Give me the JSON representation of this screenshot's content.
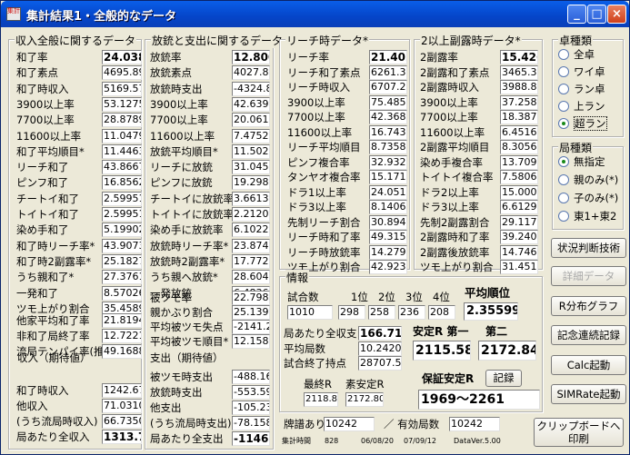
{
  "window": {
    "title": "集計結果1・全般的なデータ",
    "icon_text": "集計",
    "minimize": "_",
    "maximize": "□",
    "close": "×"
  },
  "g1": {
    "caption": "収入全般に関するデータ",
    "rows": [
      {
        "label": "和了率",
        "value": "24.038",
        "bold": true
      },
      {
        "label": "和了素点",
        "value": "4695.89"
      },
      {
        "label": "和了時収入",
        "value": "5169.57"
      },
      {
        "label": "3900以上率",
        "value": "53.1275"
      },
      {
        "label": "7700以上率",
        "value": "28.8789"
      },
      {
        "label": "11600以上率",
        "value": "11.0479"
      },
      {
        "label": "和了平均順目*",
        "value": "11.4463"
      },
      {
        "label": "リーチ和了",
        "value": "43.8667"
      },
      {
        "label": "ピンフ和了",
        "value": "16.8562"
      },
      {
        "label": "チートイ和了",
        "value": "2.59951"
      },
      {
        "label": "トイトイ和了",
        "value": "2.59951"
      },
      {
        "label": "染め手和了",
        "value": "5.19902"
      },
      {
        "label": "和了時リーチ率*",
        "value": "43.9073"
      },
      {
        "label": "和了時2副露率*",
        "value": "25.1827"
      },
      {
        "label": "うち親和了*",
        "value": "27.3761"
      },
      {
        "label": "一発和了",
        "value": "8.57026"
      },
      {
        "label": "ツモ上がり割合",
        "value": "35.4589"
      }
    ],
    "rows2": [
      {
        "label": "他家平均和了率",
        "value": "21.8194"
      },
      {
        "label": "非和了局終了率",
        "value": "12.7221"
      },
      {
        "label": "流局テンパイ率(推)",
        "value": "49.1688"
      }
    ],
    "income_caption": "収入（期待値）",
    "rows3": [
      {
        "label": "和了時収入",
        "value": "1242.67"
      },
      {
        "label": "他収入",
        "value": "71.0310"
      },
      {
        "label": "(うち流局時収入)",
        "value": "66.7350"
      },
      {
        "label": "局あたり全収入",
        "value": "1313.70",
        "bold": true
      }
    ]
  },
  "g2": {
    "caption": "放銃と支出に関するデータ",
    "rows": [
      {
        "label": "放銃率",
        "value": "12.800",
        "bold": true
      },
      {
        "label": "放銃素点",
        "value": "4027.84"
      },
      {
        "label": "放銃時支出",
        "value": "-4324.8"
      },
      {
        "label": "3900以上率",
        "value": "42.6392"
      },
      {
        "label": "7700以上率",
        "value": "20.0610"
      },
      {
        "label": "11600以上率",
        "value": "7.47520"
      },
      {
        "label": "放銃平均順目*",
        "value": "11.5026"
      },
      {
        "label": "リーチに放銃",
        "value": "31.0450"
      },
      {
        "label": "ピンフに放銃",
        "value": "19.2982"
      },
      {
        "label": "チートイに放銃率",
        "value": "3.66132"
      },
      {
        "label": "トイトイに放銃率",
        "value": "2.21205"
      },
      {
        "label": "染め手に放銃率",
        "value": "6.10221"
      },
      {
        "label": "放銃時リーチ率*",
        "value": "23.8749"
      },
      {
        "label": "放銃時2副露率*",
        "value": "17.7726"
      },
      {
        "label": "うち親へ放銃*",
        "value": "28.6041"
      },
      {
        "label": "一発放銃",
        "value": "6.48360"
      }
    ],
    "rows2": [
      {
        "label": "被ツモ率",
        "value": "22.7982"
      },
      {
        "label": "親かぶり割合",
        "value": "25.1391"
      },
      {
        "label": "平均被ツモ失点",
        "value": "-2141.2"
      },
      {
        "label": "平均被ツモ順目*",
        "value": "12.1584"
      }
    ],
    "expense_caption": "支出（期待値）",
    "rows3": [
      {
        "label": "被ツモ時支出",
        "value": "-488.16"
      },
      {
        "label": "放銃時支出",
        "value": "-553.59"
      },
      {
        "label": "他支出",
        "value": "-105.23"
      },
      {
        "label": "(うち流局時支出)",
        "value": "-78.158"
      },
      {
        "label": "局あたり全支出",
        "value": "-1146.9",
        "bold": true
      }
    ]
  },
  "g3": {
    "caption": "リーチ時データ*",
    "rows": [
      {
        "label": "リーチ率",
        "value": "21.402",
        "bold": true
      },
      {
        "label": "リーチ和了素点",
        "value": "6261.33"
      },
      {
        "label": "リーチ時収入",
        "value": "6707.21"
      },
      {
        "label": "3900以上率",
        "value": "75.4856"
      },
      {
        "label": "7700以上率",
        "value": "42.3681"
      },
      {
        "label": "11600以上率",
        "value": "16.7437"
      },
      {
        "label": "リーチ平均順目",
        "value": "8.73588"
      },
      {
        "label": "ピンフ複合率",
        "value": "32.9324"
      },
      {
        "label": "タンヤオ複合率",
        "value": "15.1711"
      },
      {
        "label": "ドラ1以上率",
        "value": "24.0518"
      },
      {
        "label": "ドラ3以上率",
        "value": "8.14061"
      },
      {
        "label": "先制リーチ割合",
        "value": "30.8940"
      },
      {
        "label": "リーチ時和了率",
        "value": "49.3156"
      },
      {
        "label": "リーチ時放銃率",
        "value": "14.2791"
      },
      {
        "label": "ツモ上がり割合",
        "value": "42.9232"
      }
    ]
  },
  "g4": {
    "caption": "2以上副露時データ*",
    "rows": [
      {
        "label": "2副露率",
        "value": "15.426",
        "bold": true
      },
      {
        "label": "2副露和了素点",
        "value": "3465.32"
      },
      {
        "label": "2副露時収入",
        "value": "3988.87"
      },
      {
        "label": "3900以上率",
        "value": "37.2580"
      },
      {
        "label": "7700以上率",
        "value": "18.3870"
      },
      {
        "label": "11600以上率",
        "value": "6.45161"
      },
      {
        "label": "2副露平均順目",
        "value": "8.30569"
      },
      {
        "label": "染め手複合率",
        "value": "13.7096"
      },
      {
        "label": "トイトイ複合率",
        "value": "7.58064"
      },
      {
        "label": "ドラ2以上率",
        "value": "15.0000"
      },
      {
        "label": "ドラ3以上率",
        "value": "6.61290"
      },
      {
        "label": "先制2副露割合",
        "value": "29.1172"
      },
      {
        "label": "2副露時和了率",
        "value": "39.2405"
      },
      {
        "label": "2副露後放銃率",
        "value": "14.7468"
      },
      {
        "label": "ツモ上がり割合",
        "value": "31.4516"
      }
    ]
  },
  "info": {
    "caption": "情報",
    "games_label": "試合数",
    "games": "1010",
    "rank_labels": [
      "1位",
      "2位",
      "3位",
      "4位"
    ],
    "ranks": [
      "298",
      "258",
      "236",
      "208"
    ],
    "avg_rank_label": "平均順位",
    "avg_rank": "2.35599",
    "rows": [
      {
        "label": "局あたり全収支",
        "value": "166.715",
        "bold": true
      },
      {
        "label": "平均局数",
        "value": "10.24200"
      },
      {
        "label": "試合終了持点",
        "value": "28707.50"
      }
    ],
    "stable_first_label": "安定R 第一",
    "stable_second_label": "第二",
    "stable_first": "2115.58",
    "stable_second": "2172.84",
    "final_r_label": "最終R",
    "final_r": "2118.80",
    "top_r_label": "素安定R",
    "top_r": "2172.80",
    "guarantee_label": "保証安定R",
    "record_button": "記録",
    "guarantee_value": "1969〜2261",
    "paifu_label": "牌譜あり",
    "paifu": "10242",
    "valid_label": "／ 有効局数",
    "valid": "10242",
    "footer_label": "集計時間",
    "footer_a": "828",
    "footer_date1": "06/08/20",
    "footer_date2": "07/09/12",
    "footer_version": "DataVer.5.00"
  },
  "table_type": {
    "caption": "卓種類",
    "options": [
      "全卓",
      "ワイ卓",
      "ラン卓",
      "上ラン",
      "超ラン"
    ],
    "selected": 4
  },
  "seat_type": {
    "caption": "局種類",
    "options": [
      "無指定",
      "親のみ(*)",
      "子のみ(*)",
      "東1+東2"
    ],
    "selected": 0
  },
  "buttons": {
    "situation": "状況判断技術",
    "detail": "詳細データ",
    "r_graph": "R分布グラフ",
    "memorial": "記念連続記録",
    "calc": "Calc起動",
    "simrate": "SIMRate起動",
    "clipboard1": "クリップボードへ",
    "clipboard2": "印刷"
  }
}
